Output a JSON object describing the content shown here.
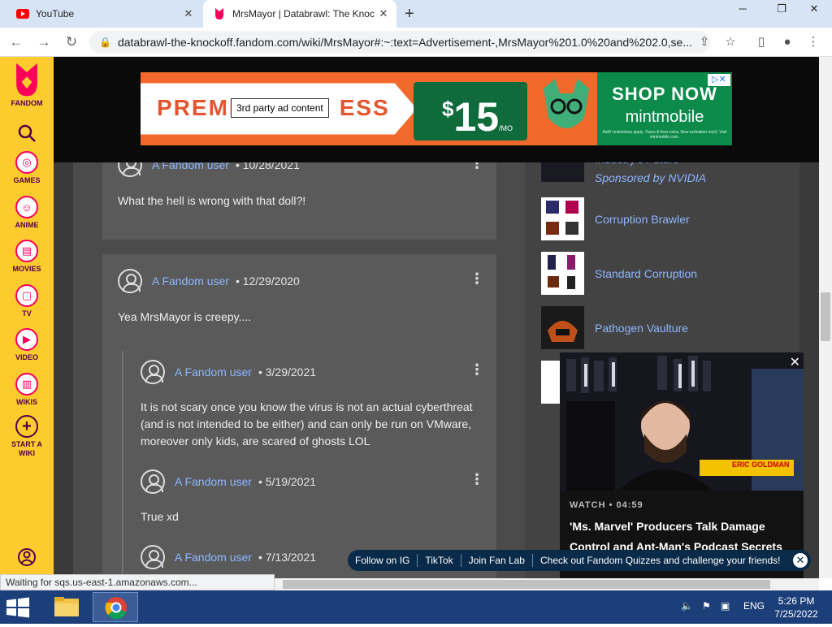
{
  "browser": {
    "tabs": [
      {
        "title": "YouTube",
        "icon": "youtube-icon",
        "active": false
      },
      {
        "title": "MrsMayor | Databrawl: The Knoc",
        "icon": "fandom-icon",
        "active": true
      }
    ],
    "url": "databrawl-the-knockoff.fandom.com/wiki/MrsMayor#:~:text=Advertisement-,MrsMayor%201.0%20and%202.0,se...",
    "status_text": "Waiting for sqs.us-east-1.amazonaws.com..."
  },
  "fandom_rail": {
    "items": [
      {
        "label": "FANDOM",
        "icon": "fandom-logo-icon"
      },
      {
        "label": "",
        "icon": "search-icon"
      },
      {
        "label": "GAMES",
        "icon": "gamepad-icon"
      },
      {
        "label": "ANIME",
        "icon": "anime-icon"
      },
      {
        "label": "MOVIES",
        "icon": "clapper-icon"
      },
      {
        "label": "TV",
        "icon": "tv-icon"
      },
      {
        "label": "VIDEO",
        "icon": "play-icon"
      },
      {
        "label": "WIKIS",
        "icon": "book-icon"
      },
      {
        "label": "START A WIKI",
        "icon": "plus-circle-icon"
      }
    ]
  },
  "ad": {
    "left_text": "PREMI",
    "left_text_tail": "ESS",
    "tooltip": "3rd party ad content",
    "price_symbol": "$",
    "price_value": "15",
    "price_unit": "/MO",
    "cta": "SHOP NOW",
    "brand": "mintmobile",
    "fine_print": "Add'l restrictions apply. Taxes & fees extra. New activation req'd. Visit mintmobile.com."
  },
  "comments": [
    {
      "user": "A Fandom user",
      "date": "10/28/2021",
      "body": "What the hell is wrong with that doll?!"
    },
    {
      "user": "A Fandom user",
      "date": "12/29/2020",
      "body": "Yea MrsMayor is creepy...."
    },
    {
      "user": "A Fandom user",
      "date": "3/29/2021",
      "body": "It is not scary once you know the virus is not an actual cyberthreat (and is not intended to be either) and can only be run on VMware, moreover only kids, are scared of ghosts LOL"
    },
    {
      "user": "A Fandom user",
      "date": "5/19/2021",
      "body": "True xd"
    },
    {
      "user": "A Fandom user",
      "date": "7/13/2021",
      "body": ""
    }
  ],
  "sidebar": {
    "partial_title": "Industry's Future",
    "sponsor": "Sponsored by NVIDIA",
    "items": [
      {
        "label": "Corruption Brawler"
      },
      {
        "label": "Standard Corruption"
      },
      {
        "label": "Pathogen Vaulture"
      }
    ]
  },
  "video": {
    "watch_label": "WATCH",
    "duration": "04:59",
    "title": "'Ms. Marvel' Producers Talk Damage Control and Ant-Man's Podcast Secrets",
    "lower_third": "ERIC GOLDMAN"
  },
  "socialbar": {
    "items": [
      "Follow on IG",
      "TikTok",
      "Join Fan Lab",
      "Check out Fandom Quizzes and challenge your friends!"
    ]
  },
  "taskbar": {
    "language": "ENG",
    "time": "5:26 PM",
    "date": "7/25/2022"
  },
  "colors": {
    "fandom_yellow": "#fecb2f",
    "fandom_pink": "#fa005a",
    "link_blue": "#8db6ff",
    "taskbar": "#1c3f7a"
  }
}
